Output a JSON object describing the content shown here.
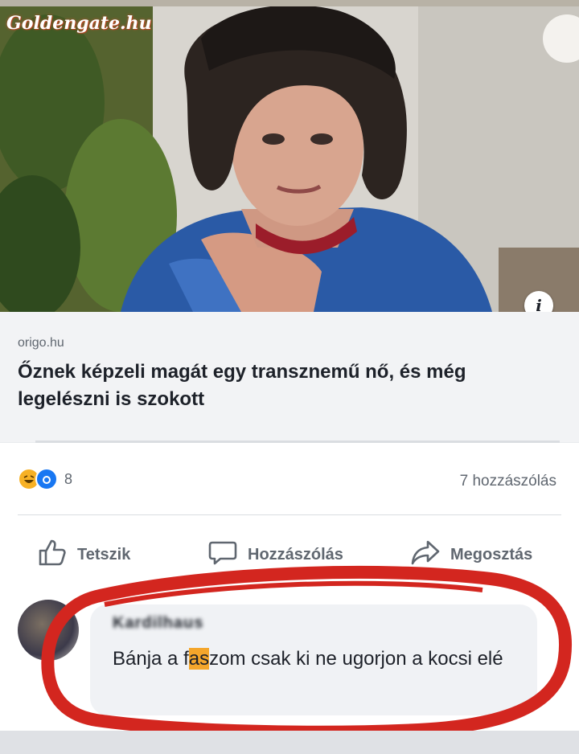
{
  "watermark": "Goldengate.hu",
  "post": {
    "image_alt": "Photo of a person with dark hair wearing a blue top and red choker",
    "info_icon": "i",
    "source": "origo.hu",
    "headline": "Őznek képzeli magát egy transznemű nő, és még legelészni is szokott"
  },
  "stats": {
    "reaction_icons": [
      "haha-icon",
      "wow-icon"
    ],
    "reaction_count": "8",
    "comment_count": "7 hozzászólás"
  },
  "actions": {
    "like": "Tetszik",
    "comment": "Hozzászólás",
    "share": "Megosztás"
  },
  "comment": {
    "author": "Kardilhaus",
    "text_before": "Bánja a f",
    "text_censored": "as",
    "text_after": "zom csak ki ne ugorjon a kocsi elé"
  },
  "colors": {
    "annotation": "#d3261f",
    "accent": "#1877f2"
  }
}
